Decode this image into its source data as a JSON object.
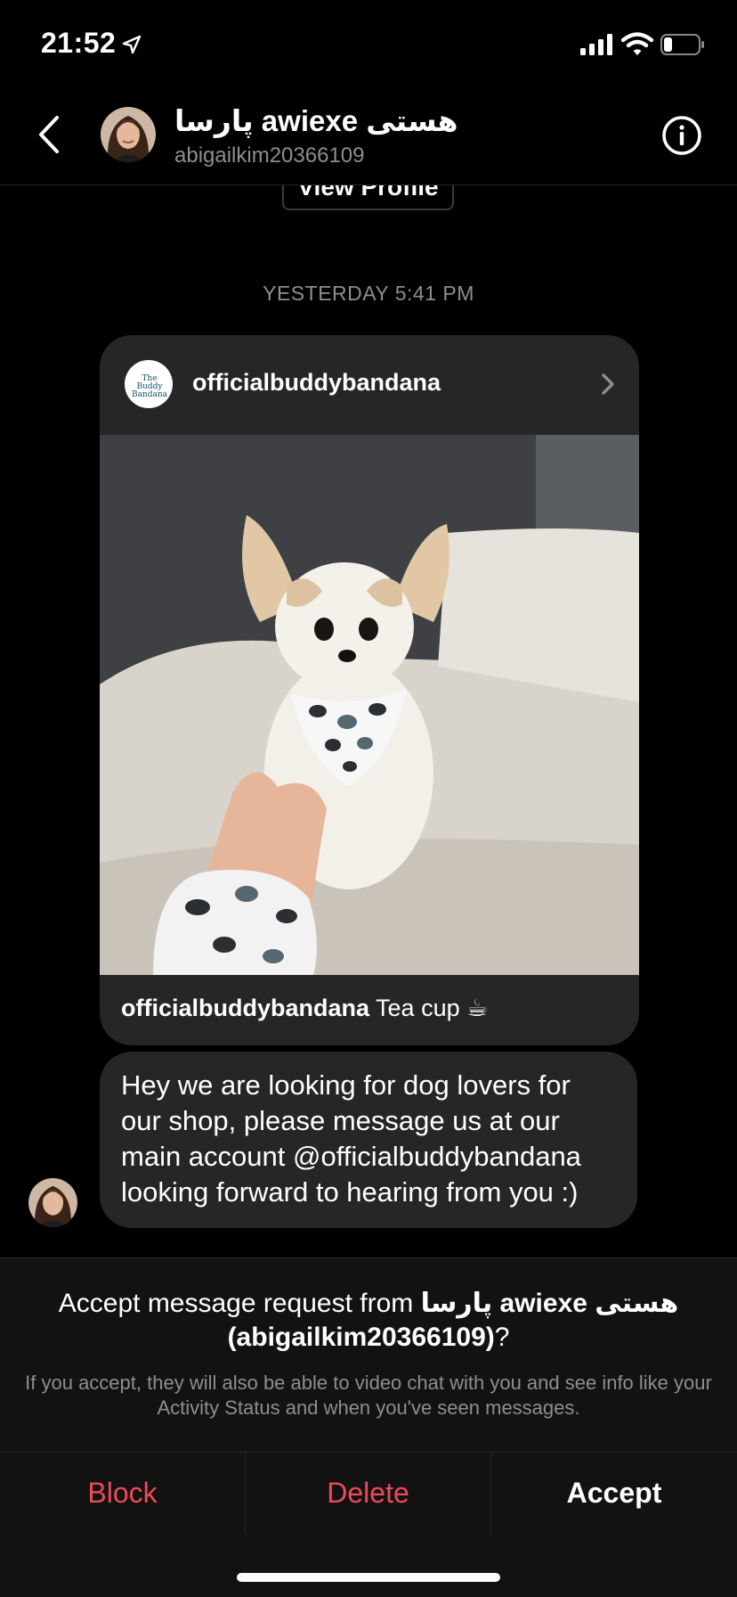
{
  "status_bar": {
    "time": "21:52",
    "icons": [
      "location-arrow-icon",
      "cellular-signal-icon",
      "wifi-icon",
      "battery-icon"
    ]
  },
  "header": {
    "display_name": "پارسا awiexe هستی",
    "username": "abigailkim20366109",
    "icons": [
      "back-chevron-icon",
      "info-icon"
    ]
  },
  "thread": {
    "view_profile_label": "View Profile",
    "timestamp": "YESTERDAY 5:41 PM",
    "shared_post": {
      "account": "officialbuddybandana",
      "avatar_text": "The Buddy Bandana",
      "caption_account": "officialbuddybandana",
      "caption_text": " Tea cup ☕"
    },
    "message": "Hey we are looking for dog lovers for our shop, please message us at our main account @officialbuddybandana looking forward to hearing from you :)"
  },
  "request": {
    "title_prefix": "Accept message request from ",
    "title_name": "پارسا awiexe هستی",
    "title_username": "(abigailkim20366109)",
    "title_suffix": "?",
    "description": "If you accept, they will also be able to video chat with you and see info like your Activity Status and when you've seen messages.",
    "actions": {
      "block": "Block",
      "delete": "Delete",
      "accept": "Accept"
    }
  },
  "colors": {
    "background": "#000000",
    "bubble": "#262626",
    "panel": "#121212",
    "secondary_text": "#8e8e8e",
    "destructive": "#ed4956"
  }
}
